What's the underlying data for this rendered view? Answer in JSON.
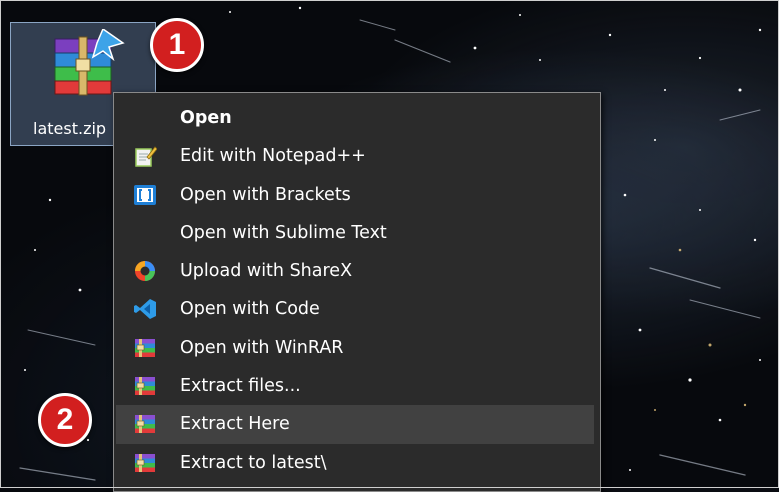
{
  "desktop_icon": {
    "label": "latest.zip",
    "icon": "winrar-archive-icon",
    "selected": true
  },
  "badges": [
    {
      "number": "1",
      "color": "#d21f1f"
    },
    {
      "number": "2",
      "color": "#d21f1f"
    }
  ],
  "context_menu": {
    "items": [
      {
        "label": "Open",
        "icon": "none",
        "default": true
      },
      {
        "label": "Edit with Notepad++",
        "icon": "notepad-plus-plus-icon"
      },
      {
        "label": "Open with Brackets",
        "icon": "brackets-icon"
      },
      {
        "label": "Open with Sublime Text",
        "icon": "none"
      },
      {
        "label": "Upload with ShareX",
        "icon": "sharex-icon"
      },
      {
        "label": "Open with Code",
        "icon": "vscode-icon"
      },
      {
        "label": "Open with WinRAR",
        "icon": "winrar-icon"
      },
      {
        "label": "Extract files...",
        "icon": "winrar-icon"
      },
      {
        "label": "Extract Here",
        "icon": "winrar-icon",
        "highlighted": true
      },
      {
        "label": "Extract to latest\\",
        "icon": "winrar-icon"
      }
    ]
  },
  "colors": {
    "menu_background": "#2b2b2b",
    "menu_highlight": "#414141",
    "menu_text": "#ffffff",
    "selection": "#7896be"
  }
}
